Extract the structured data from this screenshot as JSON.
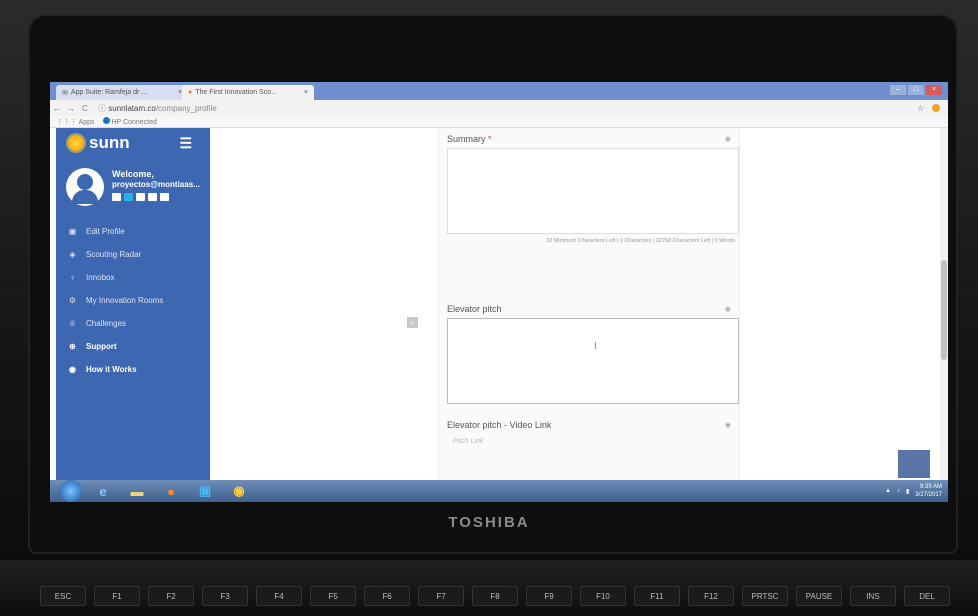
{
  "browser": {
    "tabs": [
      {
        "label": "App Suite: Ramfeja dr ..."
      },
      {
        "label": "The First Innovation Sco..."
      }
    ],
    "url_host": "sunnlatam.co",
    "url_path": "/company_profile",
    "bookmarks": [
      {
        "label": "Apps"
      },
      {
        "label": "HP Connected"
      }
    ]
  },
  "sidebar": {
    "brand": "sunn",
    "welcome": "Welcome,",
    "email": "proyectos@montiaas...",
    "items": [
      {
        "label": "Edit Profile",
        "icon": "briefcase-icon"
      },
      {
        "label": "Scouting Radar",
        "icon": "radar-icon"
      },
      {
        "label": "Innobox",
        "icon": "lightbulb-icon"
      },
      {
        "label": "My Innovation Rooms",
        "icon": "gears-icon"
      },
      {
        "label": "Challenges",
        "icon": "trophy-icon"
      },
      {
        "label": "Support",
        "icon": "plus-circle-icon"
      },
      {
        "label": "How it Works",
        "icon": "circle-icon"
      }
    ]
  },
  "form": {
    "summary": {
      "label": "Summary",
      "required_mark": "*",
      "counter": "32 Minimum Characters Left | 0 Characters | 32768 Characters Left | 0 Words"
    },
    "elevator_pitch": {
      "label": "Elevator pitch"
    },
    "video_link": {
      "label": "Elevator pitch - Video Link",
      "placeholder": "Pitch Link"
    }
  },
  "taskbar": {
    "time": "9:39 AM",
    "date": "3/27/2017"
  },
  "laptop": {
    "brand": "TOSHIBA",
    "keys": [
      "ESC",
      "F1",
      "F2",
      "F3",
      "F4",
      "F5",
      "F6",
      "F7",
      "F8",
      "F9",
      "F10",
      "F11",
      "F12",
      "PRTSC",
      "PAUSE",
      "INS",
      "DEL"
    ]
  }
}
